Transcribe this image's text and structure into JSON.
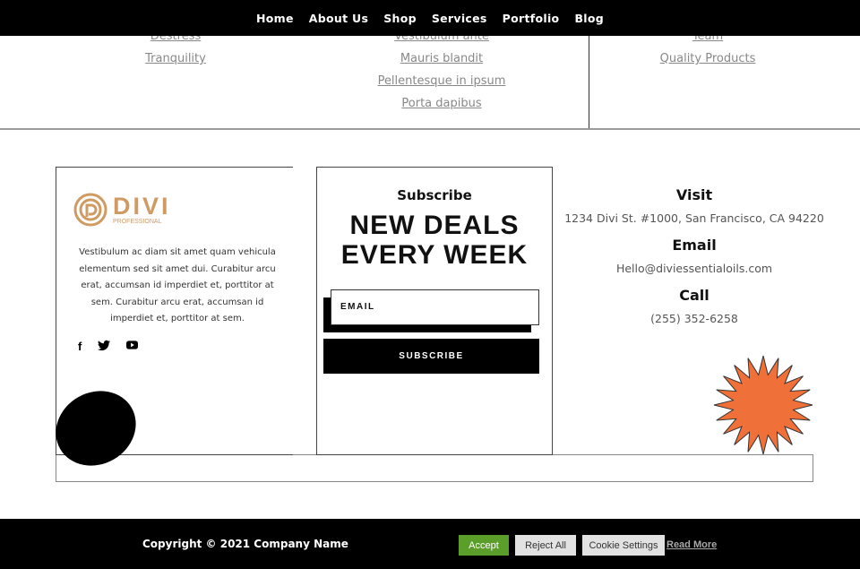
{
  "nav": [
    "Home",
    "About Us",
    "Shop",
    "Services",
    "Portfolio",
    "Blog"
  ],
  "links": {
    "col1": [
      "Destress",
      "Tranquility"
    ],
    "col2": [
      "Vestibulum ante",
      "Mauris blandit",
      "Pellentesque in ipsum",
      "Porta dapibus"
    ],
    "col3": [
      "Team",
      "Quality Products"
    ]
  },
  "brand": {
    "logo_text": "DIVI",
    "logo_sub": "PROFESSIONAL",
    "color": "#d09a63",
    "description": "Vestibulum ac diam sit amet quam vehicula elementum sed sit amet dui. Curabitur arcu erat, accumsan id imperdiet et, porttitor at sem. Curabitur arcu erat, accumsan id imperdiet et, porttitor at sem.",
    "social": [
      "facebook-icon",
      "twitter-icon",
      "youtube-icon"
    ]
  },
  "subscribe": {
    "label": "Subscribe",
    "headline1": "NEW DEALS",
    "headline2": "EVERY WEEK",
    "email_placeholder": "EMAIL",
    "button": "SUBSCRIBE"
  },
  "contact": {
    "visit_h": "Visit",
    "address": "1234 Divi St. #1000, San Francisco, CA 94220",
    "email_h": "Email",
    "email": "Hello@diviessentialoils.com",
    "call_h": "Call",
    "phone": "(255) 352-6258",
    "starburst_color": "#f0703a"
  },
  "footer": {
    "copyright": "Copyright © 2021 Company Name",
    "accept": "Accept",
    "reject": "Reject All",
    "settings": "Cookie Settings",
    "read_more": "Read More",
    "accept_color": "#5b9e2a"
  }
}
